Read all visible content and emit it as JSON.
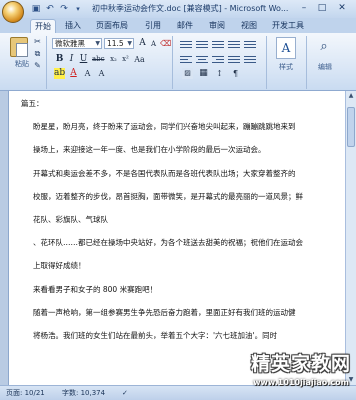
{
  "titlebar": {
    "title": "初中秋季运动会作文.doc [兼容模式] - Microsoft Wo..."
  },
  "quick_access": {
    "save_icon": "save-icon",
    "undo_icon": "undo-icon",
    "redo_icon": "redo-icon"
  },
  "tabs": [
    "开始",
    "插入",
    "页面布局",
    "引用",
    "邮件",
    "审阅",
    "视图",
    "开发工具"
  ],
  "ribbon": {
    "clipboard_label": "粘贴",
    "font_name": "微软雅黑",
    "font_size": "11.5",
    "styles_label": "样式",
    "editing_label": "编辑",
    "style_glyph": "A"
  },
  "document": {
    "lines": [
      "篇五：",
      "",
      "盼星星，盼月亮，终于盼来了运动会，同学们兴奋地尖叫起来，蹦蹦跳跳地来到",
      "",
      "操场上，来迎接这一年一度、也是我们在小学阶段的最后一次运动会。",
      "",
      "开幕式和奥运会差不多，不是各国代表队而是各班代表队出场；大家穿着整齐的",
      "",
      "校服，迈着整齐的步伐，昂首挺胸，面带微笑，是开幕式的最亮丽的一道风景；鲜",
      "",
      "花队、彩旗队、气球队",
      "",
      "、花环队……都已经在操场中央站好，为各个班送去甜美的祝福；祝他们在运动会",
      "",
      "上取得好成绩！",
      "",
      "来看看男子和女子的 800 米赛跑吧！",
      "",
      "随着一声枪响，第一组参赛男生争先恐后奋力跑着，里面正好有我们班的运动健",
      "",
      "将杨浩。我们班的女生们站在最前头，举着五个大字：'六七班加油'。同时"
    ]
  },
  "status": {
    "page": "页面: 10/21",
    "words": "字数: 10,374"
  },
  "watermark": {
    "main": "精英家教网",
    "url": "www.1010jiajiao.com"
  }
}
